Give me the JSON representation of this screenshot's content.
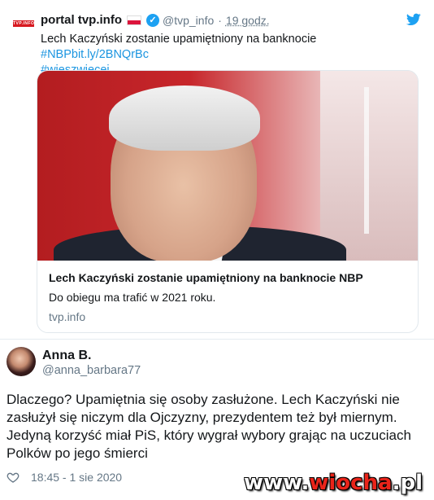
{
  "quoted": {
    "author_name": "portal tvp.info",
    "handle": "@tvp_info",
    "separator": "·",
    "time": "19 godz.",
    "logo_text": "TVP.INFO",
    "text_plain": "Lech Kaczyński zostanie upamiętniony na banknocie ",
    "text_link1": "#NBPbit.ly/2BNQrBc",
    "text_link2": "#wieszwięcej",
    "card": {
      "title": "Lech Kaczyński zostanie upamiętniony na banknocie NBP",
      "description": "Do obiegu ma trafić w 2021 roku.",
      "domain": "tvp.info"
    }
  },
  "tweet": {
    "author_name": "Anna B.",
    "handle": "@anna_barbara77",
    "text": "Dlaczego? Upamiętnia się osoby zasłużone. Lech Kaczyński nie zasłużył się niczym dla Ojczyzny, prezydentem też był miernym. Jedyną korzyść miał PiS, który wygrał wybory grając na uczuciach Polków po jego śmierci",
    "timestamp": "18:45 - 1 sie 2020"
  },
  "watermark": {
    "prefix": "www.",
    "name": "wiocha",
    "suffix": ".pl"
  },
  "colors": {
    "link": "#1b95e0",
    "verified": "#1da1f2",
    "muted": "#657786"
  }
}
